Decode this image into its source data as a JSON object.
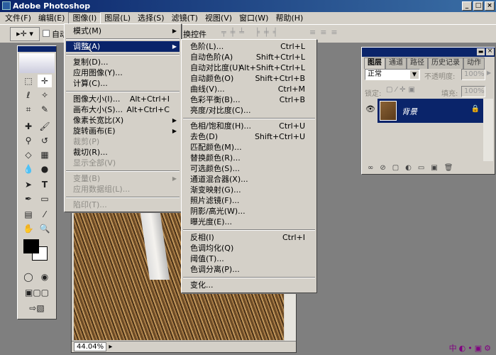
{
  "window": {
    "title": "Adobe Photoshop"
  },
  "menubar": [
    "文件(F)",
    "编辑(E)",
    "图像(I)",
    "图层(L)",
    "选择(S)",
    "滤镜(T)",
    "视图(V)",
    "窗口(W)",
    "帮助(H)"
  ],
  "options": {
    "auto_select": "自动",
    "transform_controls": "换控件"
  },
  "image_menu": [
    {
      "label": "模式(M)",
      "submenu": true
    },
    {
      "sep": true
    },
    {
      "label": "调整(A)",
      "submenu": true,
      "highlighted": true
    },
    {
      "sep": true
    },
    {
      "label": "复制(D)..."
    },
    {
      "label": "应用图像(Y)..."
    },
    {
      "label": "计算(C)..."
    },
    {
      "sep": true
    },
    {
      "label": "图像大小(I)...",
      "shortcut": "Alt+Ctrl+I"
    },
    {
      "label": "画布大小(S)...",
      "shortcut": "Alt+Ctrl+C"
    },
    {
      "label": "像素长宽比(X)",
      "submenu": true
    },
    {
      "label": "旋转画布(E)",
      "submenu": true
    },
    {
      "label": "裁剪(P)",
      "disabled": true
    },
    {
      "label": "裁切(R)..."
    },
    {
      "label": "显示全部(V)",
      "disabled": true
    },
    {
      "sep": true
    },
    {
      "label": "变量(B)",
      "submenu": true,
      "disabled": true
    },
    {
      "label": "应用数据组(L)...",
      "disabled": true
    },
    {
      "sep": true
    },
    {
      "label": "陷印(T)...",
      "disabled": true
    }
  ],
  "adjust_menu": [
    {
      "label": "色阶(L)...",
      "shortcut": "Ctrl+L"
    },
    {
      "label": "自动色阶(A)",
      "shortcut": "Shift+Ctrl+L"
    },
    {
      "label": "自动对比度(U)",
      "shortcut": "Alt+Shift+Ctrl+L"
    },
    {
      "label": "自动颜色(O)",
      "shortcut": "Shift+Ctrl+B"
    },
    {
      "label": "曲线(V)...",
      "shortcut": "Ctrl+M"
    },
    {
      "label": "色彩平衡(B)...",
      "shortcut": "Ctrl+B"
    },
    {
      "label": "亮度/对比度(C)..."
    },
    {
      "sep": true
    },
    {
      "label": "色相/饱和度(H)...",
      "shortcut": "Ctrl+U"
    },
    {
      "label": "去色(D)",
      "shortcut": "Shift+Ctrl+U"
    },
    {
      "label": "匹配颜色(M)..."
    },
    {
      "label": "替换颜色(R)..."
    },
    {
      "label": "可选颜色(S)..."
    },
    {
      "label": "通道混合器(X)..."
    },
    {
      "label": "渐变映射(G)..."
    },
    {
      "label": "照片滤镜(F)..."
    },
    {
      "label": "阴影/高光(W)..."
    },
    {
      "label": "曝光度(E)..."
    },
    {
      "sep": true
    },
    {
      "label": "反相(I)",
      "shortcut": "Ctrl+I"
    },
    {
      "label": "色调均化(Q)"
    },
    {
      "label": "阈值(T)..."
    },
    {
      "label": "色调分离(P)..."
    },
    {
      "sep": true
    },
    {
      "label": "变化..."
    }
  ],
  "layers_panel": {
    "tabs": [
      "图层",
      "通道",
      "路径",
      "历史记录",
      "动作"
    ],
    "blend_mode": "正常",
    "opacity_label": "不透明度:",
    "opacity": "100%",
    "lock_label": "锁定:",
    "fill_label": "填充:",
    "fill": "100%",
    "layers": [
      {
        "name": "背景",
        "locked": true,
        "visible": true
      }
    ]
  },
  "document": {
    "zoom": "44.04%"
  },
  "colors": {
    "titlebar": "#0a246a",
    "menu_bg": "#d4d0c8",
    "highlight": "#0a246a"
  }
}
